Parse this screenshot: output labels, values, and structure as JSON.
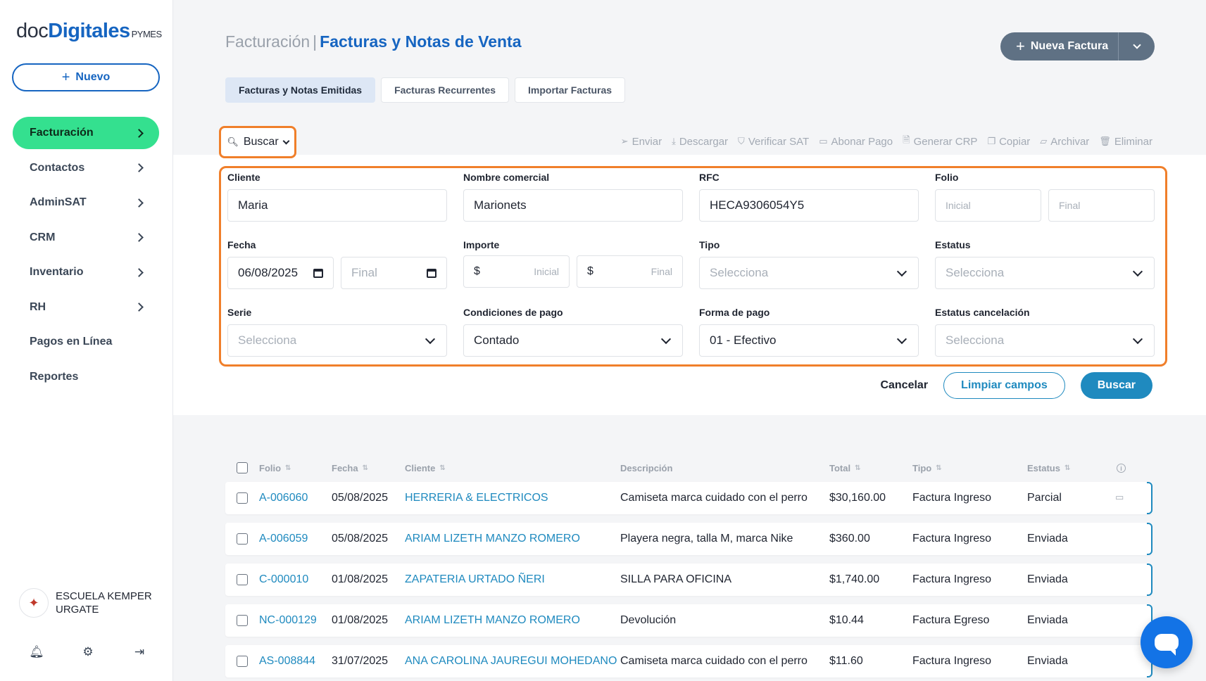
{
  "brand": {
    "doc": "doc",
    "digitales": "Digitales",
    "pymes": "PYMES"
  },
  "sidebar": {
    "new_label": "Nuevo",
    "items": [
      {
        "label": "Facturación",
        "chevron": true,
        "active": true
      },
      {
        "label": "Contactos",
        "chevron": true
      },
      {
        "label": "AdminSAT",
        "chevron": true
      },
      {
        "label": "CRM",
        "chevron": true
      },
      {
        "label": "Inventario",
        "chevron": true
      },
      {
        "label": "RH",
        "chevron": true
      },
      {
        "label": "Pagos en Línea",
        "chevron": false
      },
      {
        "label": "Reportes",
        "chevron": false
      }
    ],
    "company_name": "ESCUELA KEMPER URGATE",
    "bottom_icons": [
      "bell-icon",
      "gear-icon",
      "logout-icon"
    ]
  },
  "header": {
    "crumb": "Facturación",
    "separator": "|",
    "title": "Facturas y Notas de Venta",
    "primary_action": "Nueva Factura"
  },
  "tabs": [
    {
      "label": "Facturas y Notas Emitidas",
      "active": true
    },
    {
      "label": "Facturas Recurrentes"
    },
    {
      "label": "Importar Facturas"
    }
  ],
  "search_toggle": "Buscar",
  "toolbar": [
    "Enviar",
    "Descargar",
    "Verificar SAT",
    "Abonar Pago",
    "Generar CRP",
    "Copiar",
    "Archivar",
    "Eliminar"
  ],
  "filters": {
    "cliente": {
      "label": "Cliente",
      "value": "Maria"
    },
    "nombre_comercial": {
      "label": "Nombre comercial",
      "value": "Marionets"
    },
    "rfc": {
      "label": "RFC",
      "value": "HECA9306054Y5"
    },
    "folio": {
      "label": "Folio",
      "start_placeholder": "Inicial",
      "end_placeholder": "Final"
    },
    "fecha": {
      "label": "Fecha",
      "start_value": "06/08/2025",
      "end_placeholder": "Final"
    },
    "importe": {
      "label": "Importe",
      "currency": "$",
      "start_placeholder": "Inicial",
      "end_placeholder": "Final"
    },
    "tipo": {
      "label": "Tipo",
      "placeholder": "Selecciona"
    },
    "estatus": {
      "label": "Estatus",
      "placeholder": "Selecciona"
    },
    "serie": {
      "label": "Serie",
      "placeholder": "Selecciona"
    },
    "condiciones_pago": {
      "label": "Condiciones de pago",
      "value": "Contado"
    },
    "forma_pago": {
      "label": "Forma de pago",
      "value": "01 - Efectivo"
    },
    "estatus_cancelacion": {
      "label": "Estatus cancelación",
      "placeholder": "Selecciona"
    }
  },
  "actions": {
    "cancel": "Cancelar",
    "clear": "Limpiar campos",
    "search": "Buscar"
  },
  "table": {
    "columns": {
      "folio": "Folio",
      "fecha": "Fecha",
      "cliente": "Cliente",
      "descripcion": "Descripción",
      "total": "Total",
      "tipo": "Tipo",
      "estatus": "Estatus"
    },
    "rows": [
      {
        "folio": "A-006060",
        "fecha": "05/08/2025",
        "cliente": "HERRERIA & ELECTRICOS",
        "descripcion": "Camiseta marca cuidado con el perro",
        "total": "$30,160.00",
        "tipo": "Factura Ingreso",
        "estatus": "Parcial"
      },
      {
        "folio": "A-006059",
        "fecha": "05/08/2025",
        "cliente": "ARIAM LIZETH MANZO ROMERO",
        "descripcion": "Playera negra, talla M, marca Nike",
        "total": "$360.00",
        "tipo": "Factura Ingreso",
        "estatus": "Enviada"
      },
      {
        "folio": "C-000010",
        "fecha": "01/08/2025",
        "cliente": "ZAPATERIA URTADO ÑERI",
        "descripcion": "SILLA PARA OFICINA",
        "total": "$1,740.00",
        "tipo": "Factura Ingreso",
        "estatus": "Enviada"
      },
      {
        "folio": "NC-000129",
        "fecha": "01/08/2025",
        "cliente": "ARIAM LIZETH MANZO ROMERO",
        "descripcion": "Devolución",
        "total": "$10.44",
        "tipo": "Factura Egreso",
        "estatus": "Enviada"
      },
      {
        "folio": "AS-008844",
        "fecha": "31/07/2025",
        "cliente": "ANA CAROLINA JAUREGUI MOHEDANO",
        "descripcion": "Camiseta marca cuidado con el perro",
        "total": "$11.60",
        "tipo": "Factura Ingreso",
        "estatus": "Enviada"
      }
    ]
  },
  "colors": {
    "brand_blue": "#1665c1",
    "active_green": "#34e08f",
    "link_blue": "#1f8abf",
    "highlight_orange": "#f07f2a",
    "chat_blue": "#1373e6"
  }
}
